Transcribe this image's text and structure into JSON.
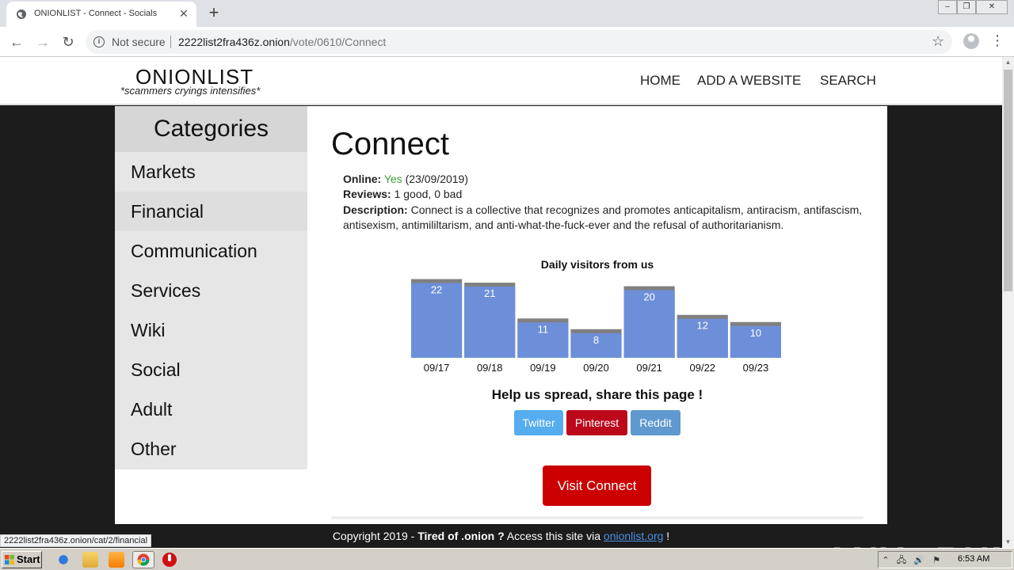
{
  "browser": {
    "tab_title": "ONIONLIST - Connect - Socials",
    "tab_close": "✕",
    "new_tab": "+",
    "not_secure": "Not secure",
    "url_host": "2222list2fra436z.onion",
    "url_path": "/vote/0610/Connect",
    "status_url": "2222list2fra436z.onion/cat/2/financial"
  },
  "site": {
    "logo": "ONIONLIST",
    "tagline": "*scammers cryings intensifies*",
    "nav": [
      "HOME",
      "ADD A WEBSITE",
      "SEARCH"
    ]
  },
  "sidebar": {
    "title": "Categories",
    "items": [
      "Markets",
      "Financial",
      "Communication",
      "Services",
      "Wiki",
      "Social",
      "Adult",
      "Other"
    ]
  },
  "main": {
    "title": "Connect",
    "online_label": "Online:",
    "online_value": "Yes",
    "online_date": "(23/09/2019)",
    "reviews_label": "Reviews:",
    "reviews_value": "1 good, 0 bad",
    "description_label": "Description:",
    "description_text": "Connect is a collective that recognizes and promotes anticapitalism, antiracism, antifascism, antisexism, antimililtarism, and anti-what-the-fuck-ever and the refusal of authoritarianism.",
    "share_title": "Help us spread, share this page !",
    "share_buttons": [
      "Twitter",
      "Pinterest",
      "Reddit"
    ],
    "visit_button": "Visit Connect"
  },
  "colors": {
    "bar": "#6d8fd9",
    "bar_cap": "#808080",
    "twitter": "#55acee",
    "pinterest": "#bd081c",
    "reddit": "#5f99cf",
    "visit": "#cc0000",
    "online": "#3aa03a"
  },
  "chart_data": {
    "type": "bar",
    "title": "Daily visitors from us",
    "categories": [
      "09/17",
      "09/18",
      "09/19",
      "09/20",
      "09/21",
      "09/22",
      "09/23"
    ],
    "values": [
      22,
      21,
      11,
      8,
      20,
      12,
      10
    ],
    "xlabel": "",
    "ylabel": "",
    "ylim": [
      0,
      23
    ],
    "grid": false
  },
  "footer": {
    "prefix": "Copyright 2019 - ",
    "bold": "Tired of .onion ?",
    "middle": " Access this site via ",
    "link": "onionlist.org",
    "suffix": " !"
  },
  "watermark": "ANY▷RUN",
  "taskbar": {
    "start": "Start",
    "time": "6:53 AM"
  }
}
